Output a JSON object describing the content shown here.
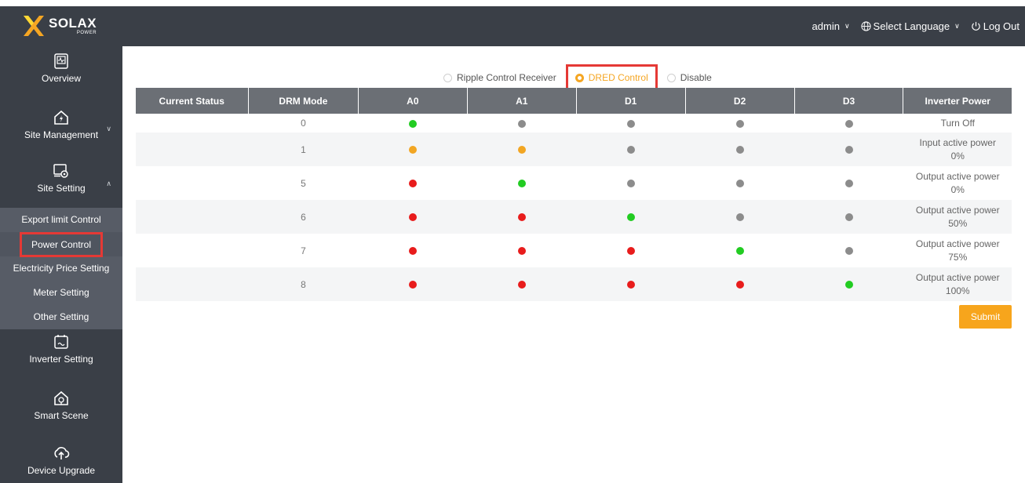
{
  "brand": {
    "word": "SOLAX",
    "sub": "POWER"
  },
  "topbar": {
    "user": "admin",
    "language": "Select Language",
    "logout": "Log Out"
  },
  "sidebar": {
    "items": [
      {
        "label": "Overview",
        "icon": "overview-icon"
      },
      {
        "label": "Site Management",
        "icon": "site-management-icon"
      },
      {
        "label": "Site Setting",
        "icon": "site-setting-icon"
      },
      {
        "label": "Inverter Setting",
        "icon": "inverter-setting-icon"
      },
      {
        "label": "Smart Scene",
        "icon": "smart-scene-icon"
      },
      {
        "label": "Device Upgrade",
        "icon": "device-upgrade-icon"
      }
    ],
    "submenu": [
      "Export limit Control",
      "Power Control",
      "Electricity Price Setting",
      "Meter Setting",
      "Other Setting"
    ]
  },
  "control_mode": {
    "options": [
      "Ripple Control Receiver",
      "DRED Control",
      "Disable"
    ],
    "selected": "DRED Control"
  },
  "table": {
    "headers": [
      "Current Status",
      "DRM Mode",
      "A0",
      "A1",
      "D1",
      "D2",
      "D3",
      "Inverter Power"
    ],
    "rows": [
      {
        "mode": "0",
        "leds": [
          "green",
          "gray",
          "gray",
          "gray",
          "gray"
        ],
        "power": [
          "Turn Off",
          ""
        ]
      },
      {
        "mode": "1",
        "leds": [
          "orange",
          "orange",
          "gray",
          "gray",
          "gray"
        ],
        "power": [
          "Input active power",
          "0%"
        ]
      },
      {
        "mode": "5",
        "leds": [
          "red",
          "green",
          "gray",
          "gray",
          "gray"
        ],
        "power": [
          "Output active power",
          "0%"
        ]
      },
      {
        "mode": "6",
        "leds": [
          "red",
          "red",
          "green",
          "gray",
          "gray"
        ],
        "power": [
          "Output active power",
          "50%"
        ]
      },
      {
        "mode": "7",
        "leds": [
          "red",
          "red",
          "red",
          "green",
          "gray"
        ],
        "power": [
          "Output active power",
          "75%"
        ]
      },
      {
        "mode": "8",
        "leds": [
          "red",
          "red",
          "red",
          "red",
          "green"
        ],
        "power": [
          "Output active power",
          "100%"
        ]
      }
    ]
  },
  "actions": {
    "submit": "Submit"
  },
  "colors": {
    "accent": "#f7a51c",
    "led_green": "#22cc22",
    "led_red": "#e81c1c",
    "led_orange": "#f2a623",
    "led_gray": "#8c8c8c"
  }
}
